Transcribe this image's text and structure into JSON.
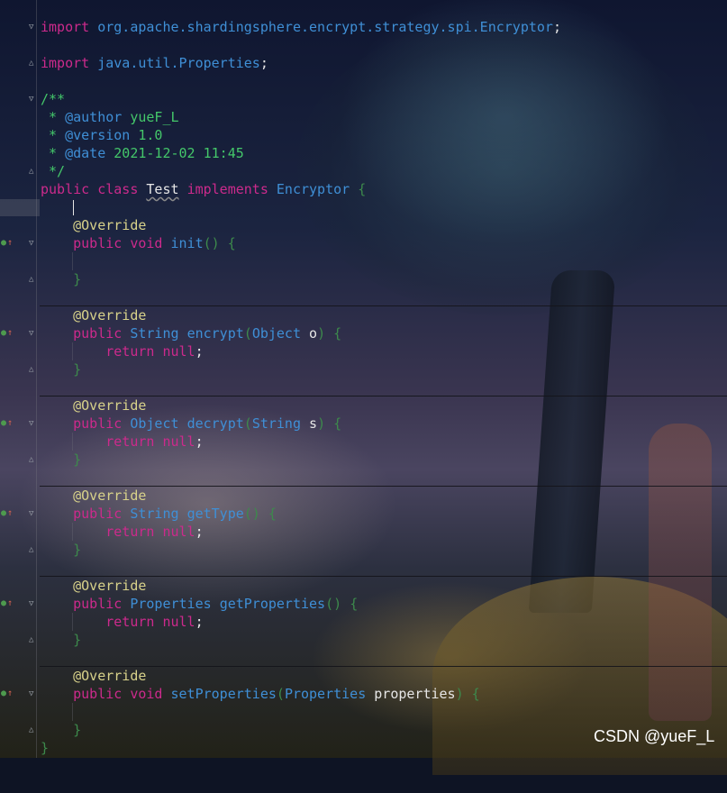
{
  "code": {
    "import_kw": "import",
    "import1_pkg": "org.apache.shardingsphere.encrypt.strategy.spi.Encryptor",
    "import2_pkg": "java.util.Properties",
    "semicolon": ";",
    "javadoc_open": "/**",
    "javadoc_star": " * ",
    "tag_author": "@author",
    "val_author": " yueF_L",
    "tag_version": "@version",
    "val_version": " 1.0",
    "tag_date": "@date",
    "val_date": " 2021-12-02 11:45",
    "javadoc_close": " */",
    "kw_public": "public",
    "kw_class": "class",
    "class_name": "Test",
    "kw_implements": "implements",
    "iface_name": "Encryptor",
    "brace_open": "{",
    "brace_close": "}",
    "annotation": "@Override",
    "kw_void": "void",
    "kw_return": "return",
    "kw_null": "null",
    "paren_open": "(",
    "paren_close": ")",
    "empty_parens": "()",
    "methods": [
      {
        "name": "init"
      },
      {
        "ret": "String",
        "name": "encrypt",
        "ptype": "Object",
        "pname": "o"
      },
      {
        "ret": "Object",
        "name": "decrypt",
        "ptype": "String",
        "pname": "s"
      },
      {
        "ret": "String",
        "name": "getType"
      },
      {
        "ret": "Properties",
        "name": "getProperties"
      },
      {
        "name": "setProperties",
        "ptype": "Properties",
        "pname": "properties"
      }
    ]
  },
  "watermark": "CSDN @yueF_L"
}
